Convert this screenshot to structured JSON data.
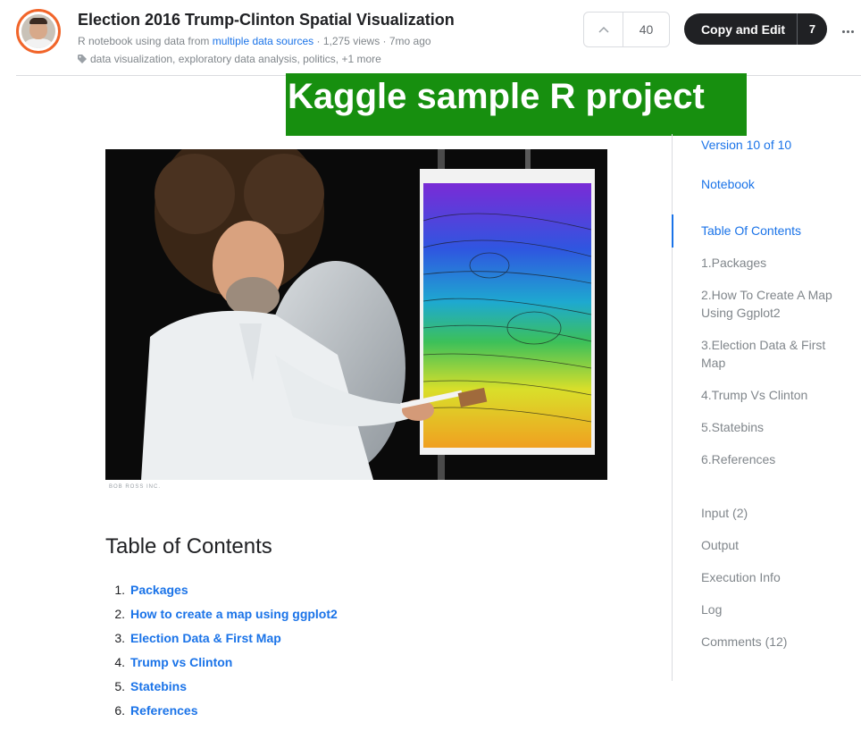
{
  "header": {
    "title": "Election 2016 Trump-Clinton Spatial Visualization",
    "meta_prefix": "R notebook using data from",
    "meta_link": "multiple data sources",
    "meta_suffix": "· 1,275 views · 7mo ago",
    "tags": "data visualization, exploratory data analysis, politics, +1 more",
    "vote_count": "40",
    "copy_label": "Copy and Edit",
    "copy_count": "7"
  },
  "banner": {
    "text": "Kaggle sample R project"
  },
  "image": {
    "credit": "BOB ROSS INC."
  },
  "content": {
    "toc_heading": "Table of Contents",
    "toc": [
      {
        "num": "1.",
        "label": "Packages"
      },
      {
        "num": "2.",
        "label": "How to create a map using ggplot2"
      },
      {
        "num": "3.",
        "label": "Election Data & First Map"
      },
      {
        "num": "4.",
        "label": "Trump vs Clinton"
      },
      {
        "num": "5.",
        "label": "Statebins"
      },
      {
        "num": "6.",
        "label": "References"
      }
    ]
  },
  "sidebar": {
    "version": "Version 10 of 10",
    "notebook": "Notebook",
    "toc_title": "Table Of Contents",
    "toc": [
      "1.Packages",
      "2.How To Create A Map Using Ggplot2",
      "3.Election Data & First Map",
      "4.Trump Vs Clinton",
      "5.Statebins",
      "6.References"
    ],
    "input": "Input (2)",
    "output": "Output",
    "execution": "Execution Info",
    "log": "Log",
    "comments": "Comments (12)"
  },
  "colors": {
    "accent": "#1a73e8",
    "banner": "#178f0f",
    "avatar_ring": "#f1652a",
    "button_dark": "#202124"
  },
  "icons": [
    "tag-icon",
    "chevron-up-icon",
    "more-horizontal-icon"
  ]
}
